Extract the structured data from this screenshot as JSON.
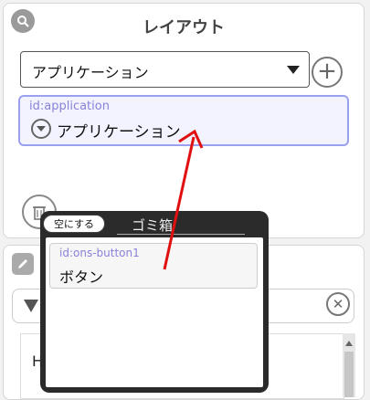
{
  "layout_panel": {
    "title": "レイアウト",
    "select_value": "アプリケーション",
    "selected_item": {
      "id": "id:application",
      "label": "アプリケーション"
    }
  },
  "trash_popup": {
    "title": "ゴミ箱",
    "empty_button": "空にする",
    "items": [
      {
        "id": "id:ons-button1",
        "label": "ボタン"
      }
    ]
  },
  "lower_panel": {
    "list_first_text": "H"
  },
  "colors": {
    "selection_border": "#9aa0f0",
    "id_label": "#8a82d8",
    "arrow": "#e01010"
  },
  "icons": [
    "search-icon",
    "chevron-down-icon",
    "plus-icon",
    "trash-icon",
    "edit-icon",
    "filter-icon",
    "close-icon"
  ]
}
